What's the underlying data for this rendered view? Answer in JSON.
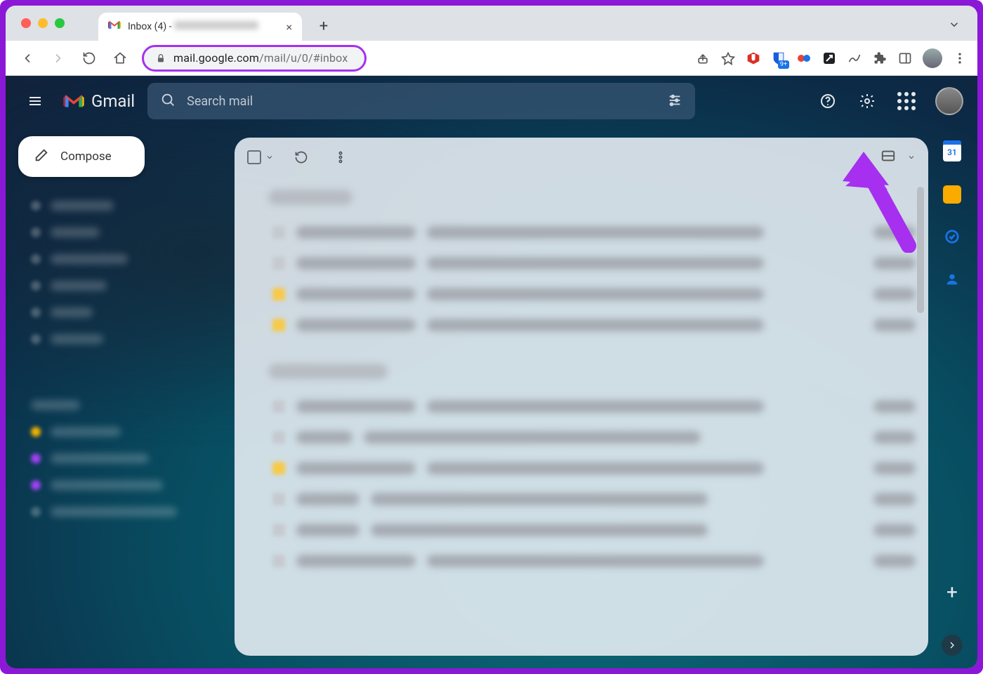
{
  "browser": {
    "tab_title_prefix": "Inbox (4) - ",
    "url_host": "mail.google.com",
    "url_path": "/mail/u/0/#inbox"
  },
  "gmail": {
    "product": "Gmail",
    "search_placeholder": "Search mail",
    "compose": "Compose",
    "calendar_day": "31"
  },
  "annotation": {
    "highlight_color": "#a62ff0"
  }
}
